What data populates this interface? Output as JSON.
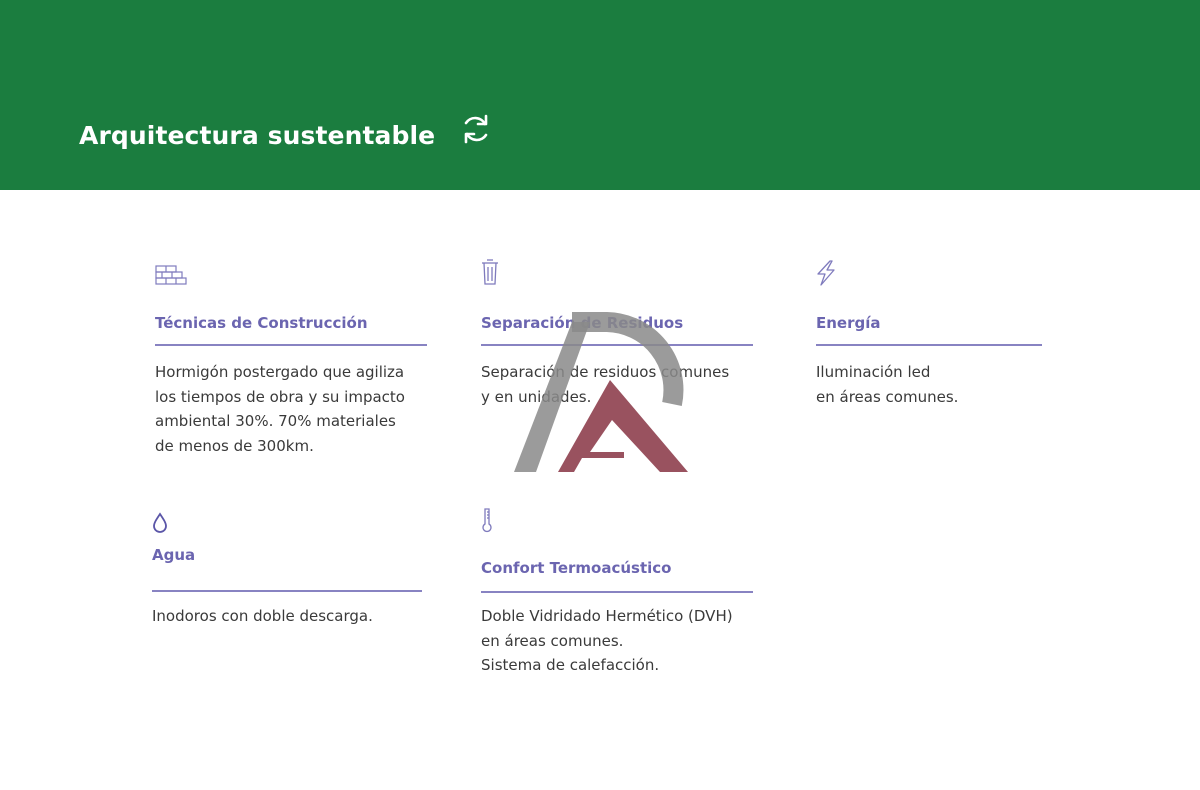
{
  "header": {
    "title": "Arquitectura sustentable",
    "refresh_icon": "refresh-icon",
    "background_color": "#1b7d3f"
  },
  "features": [
    {
      "icon": "brick-wall-icon",
      "title": "Técnicas de Construcción",
      "description": "Hormigón postergado que agiliza\nlos tiempos de obra y su impacto\nambiental 30%. 70% materiales\nde menos de 300km."
    },
    {
      "icon": "trash-bin-icon",
      "title": "Separación de Residuos",
      "description": "Separación de residuos comunes\ny en unidades."
    },
    {
      "icon": "lightning-icon",
      "title": "Energía",
      "description": "Iluminación led\nen áreas comunes."
    },
    {
      "icon": "water-drop-icon",
      "title": "Agua",
      "description": "Inodoros con doble descarga."
    },
    {
      "icon": "thermometer-icon",
      "title": "Confort Termoacústico",
      "description": "Doble Vidridado Hermético (DVH)\nen áreas comunes.\nSistema de calefacción."
    }
  ],
  "colors": {
    "accent_title": "#6b65b0",
    "rule": "#8883c2",
    "body_text": "#3a3a3a",
    "watermark_gray": "#8a8a8a",
    "watermark_red": "#8e3f4e"
  },
  "watermark": {
    "icon": "brand-logo-watermark"
  }
}
